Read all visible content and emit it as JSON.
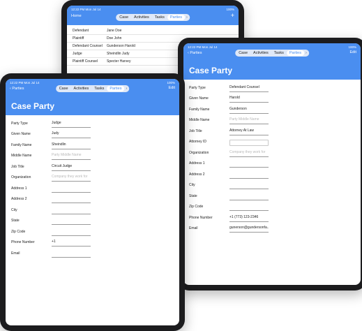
{
  "colors": {
    "header_blue": "#4a8ef0",
    "placeholder_gray": "#b9b9b9"
  },
  "back_tablet": {
    "status_time": "12:22 PM  Mon Jul 14",
    "status_right": "100%",
    "nav_left": "Home",
    "nav_right": "+",
    "tabs": [
      "Case",
      "Activities",
      "Tasks",
      "Parties"
    ],
    "rows": [
      {
        "role": "Defendant",
        "name": "Jane Doe"
      },
      {
        "role": "Plaintiff",
        "name": "Doe John"
      },
      {
        "role": "Defendant Counsel",
        "name": "Gunderson Harold"
      },
      {
        "role": "Judge",
        "name": "Sheindlin Judy"
      },
      {
        "role": "Plaintiff Counsel",
        "name": "Specter Harvey"
      }
    ]
  },
  "right_tablet": {
    "status_time": "12:22 PM  Mon Jul 14",
    "status_right": "100%",
    "nav_left": "Parties",
    "nav_right": "Edit",
    "tabs": [
      "Case",
      "Activities",
      "Tasks",
      "Parties"
    ],
    "title": "Case Party",
    "fields": [
      {
        "label": "Party Type",
        "value": "Defendant Counsel"
      },
      {
        "label": "Given Name",
        "value": "Harold"
      },
      {
        "label": "Family Name",
        "value": "Gunderson"
      },
      {
        "label": "Middle Name",
        "placeholder": "Party Middle Name"
      },
      {
        "label": "Job Title",
        "value": "Attorney At Law"
      },
      {
        "label": "Attorney ID",
        "value": "",
        "boxed": true
      },
      {
        "label": "Organization",
        "placeholder": "Company they work for"
      },
      {
        "label": "Address 1",
        "value": ""
      },
      {
        "label": "Address 2",
        "value": ""
      },
      {
        "label": "City",
        "value": ""
      },
      {
        "label": "State",
        "value": ""
      },
      {
        "label": "Zip Code",
        "value": ""
      },
      {
        "label": "Phone Number",
        "value": "+1 (773) 123-2346"
      },
      {
        "label": "Email",
        "value": "gunerson@gundersonfa..."
      }
    ]
  },
  "left_tablet": {
    "status_time": "12:22 PM  Mon Jul 14",
    "status_right": "100%",
    "nav_left": "Parties",
    "nav_right": "Edit",
    "tabs": [
      "Case",
      "Activities",
      "Tasks",
      "Parties"
    ],
    "title": "Case Party",
    "fields": [
      {
        "label": "Party Type",
        "value": "Judge"
      },
      {
        "label": "Given Name",
        "value": "Judy"
      },
      {
        "label": "Family Name",
        "value": "Sheindlin"
      },
      {
        "label": "Middle Name",
        "placeholder": "Party Middle Name"
      },
      {
        "label": "Job Title",
        "value": "Circuit Judge"
      },
      {
        "label": "Organization",
        "placeholder": "Company they work for"
      },
      {
        "label": "Address 1",
        "value": ""
      },
      {
        "label": "Address 2",
        "value": ""
      },
      {
        "label": "City",
        "value": ""
      },
      {
        "label": "State",
        "value": ""
      },
      {
        "label": "Zip Code",
        "value": ""
      },
      {
        "label": "Phone Number",
        "value": "+1"
      },
      {
        "label": "Email",
        "value": ""
      }
    ]
  }
}
